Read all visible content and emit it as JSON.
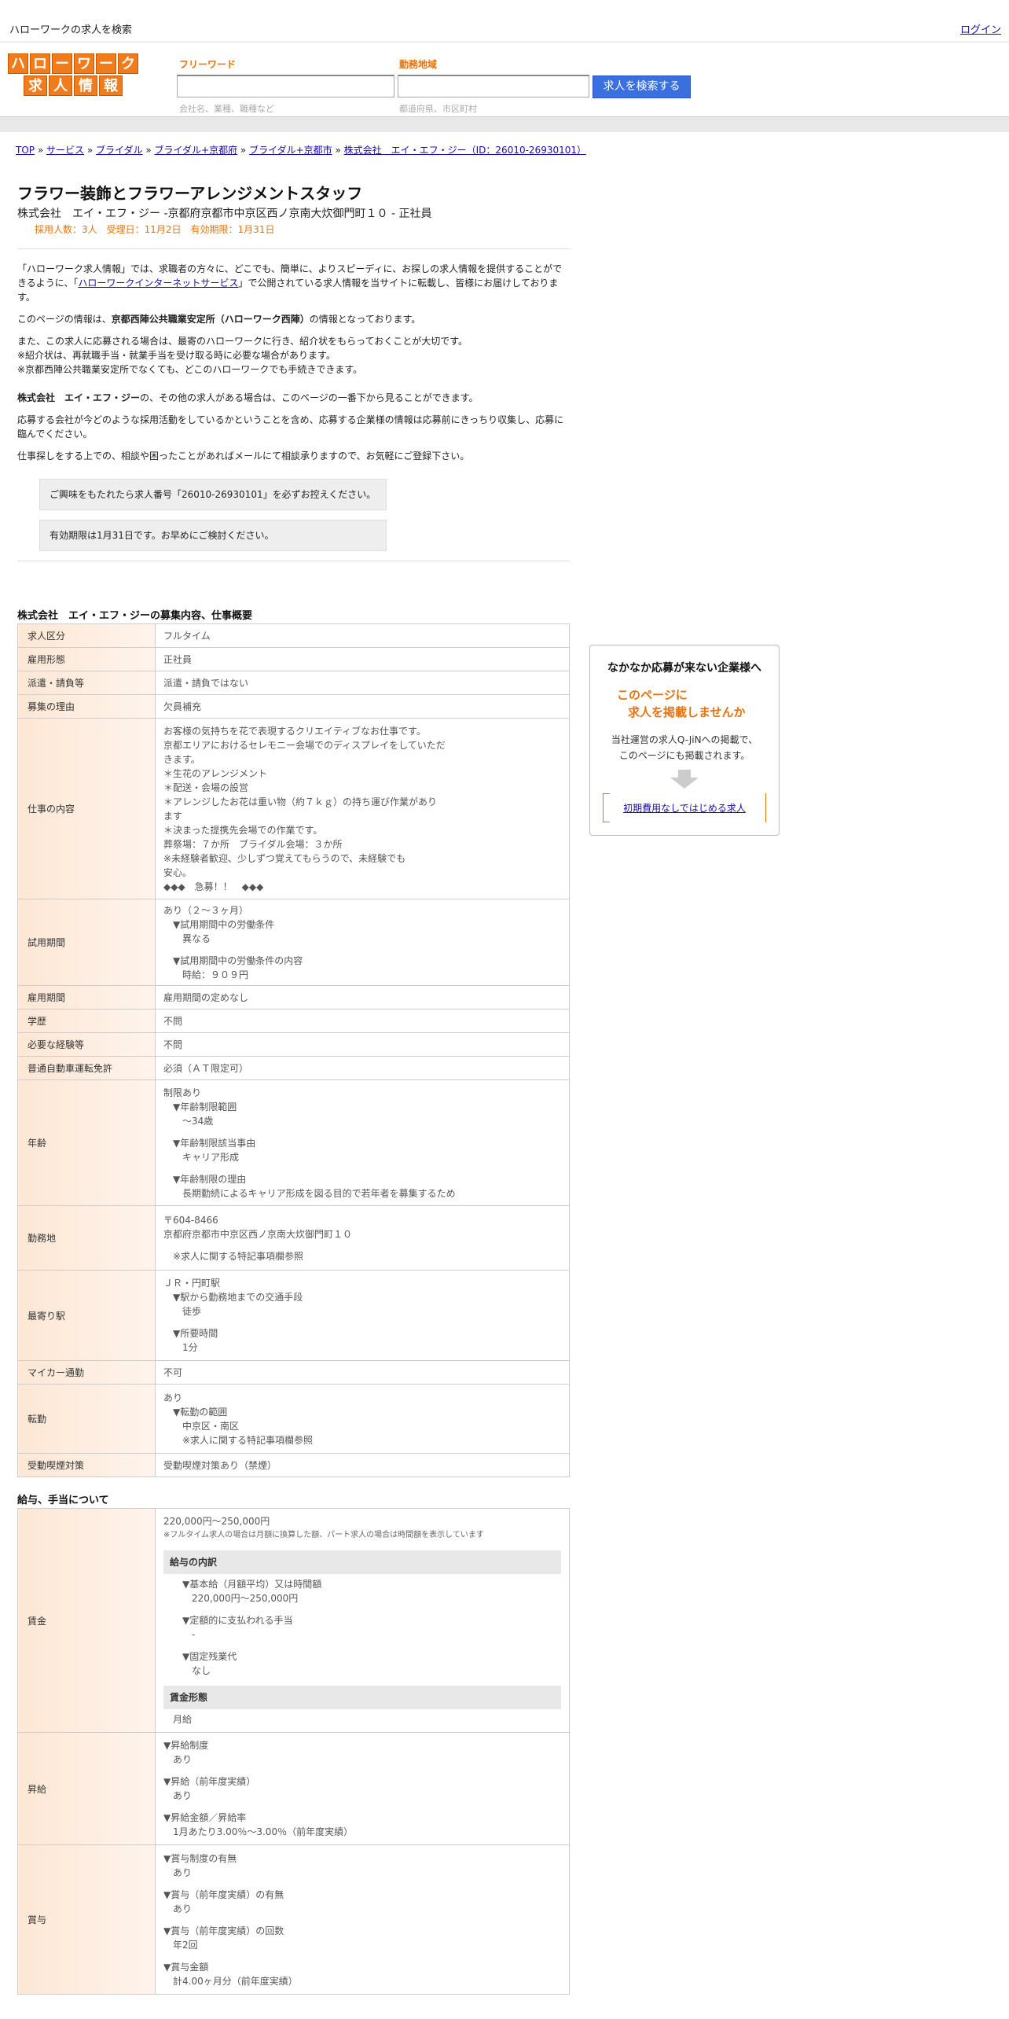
{
  "topbar": {
    "title": "ハローワークの求人を検索",
    "login": "ログイン"
  },
  "logo": {
    "row1": [
      "ハ",
      "ロ",
      "ー",
      "ワ",
      "ー",
      "ク"
    ],
    "row2": [
      "求",
      "人",
      "情",
      "報"
    ]
  },
  "search": {
    "free_label": "フリーワード",
    "free_hint": "会社名、業種、職種など",
    "area_label": "勤務地域",
    "area_hint": "都道府県、市区町村",
    "button": "求人を検索する"
  },
  "breadcrumb": {
    "items": [
      "TOP",
      "サービス",
      "ブライダル",
      "ブライダル+京都府",
      "ブライダル+京都市",
      "株式会社　エイ・エフ・ジー（ID：26010-26930101）"
    ],
    "sep": " » "
  },
  "job": {
    "title": "フラワー装飾とフラワーアレンジメントスタッフ",
    "subtitle": "株式会社　エイ・エフ・ジー -京都府京都市中京区西ノ京南大炊御門町１０ - 正社員",
    "meta": "採用人数：3人　受理日：11月2日　有効期限：1月31日"
  },
  "intro": {
    "p1a": "「ハローワーク求人情報」では、求職者の方々に、どこでも、簡単に、よりスピーディに、お探しの求人情報を提供することができるように、「",
    "p1link": "ハローワークインターネットサービス",
    "p1b": "」で公開されている求人情報を当サイトに転載し、皆様にお届けしております。",
    "p2a": "このページの情報は、",
    "p2b": "京都西陣公共職業安定所（ハローワーク西陣）",
    "p2c": "の情報となっております。",
    "p3a": "また、この求人に応募される場合は、最寄のハローワークに行き、紹介状をもらっておくことが大切です。",
    "p3b": "※紹介状は、再就職手当・就業手当を受け取る時に必要な場合があります。",
    "p3c": "※京都西陣公共職業安定所でなくても、どこのハローワークでも手続きできます。",
    "p4a": "株式会社　エイ・エフ・ジー",
    "p4b": "の、その他の求人がある場合は、このページの一番下から見ることができます。",
    "p5": "応募する会社が今どのような採用活動をしているかということを含め、応募する企業様の情報は応募前にきっちり収集し、応募に臨んでください。",
    "p6": "仕事探しをする上での、相談や困ったことがあればメールにて相談承りますので、お気軽にご登録下さい。",
    "note1": "ご興味をもたれたら求人番号「26010-26930101」を必ずお控えください。",
    "note2": "有効期限は1月31日です。お早めにご検討ください。"
  },
  "section1": {
    "title": "株式会社　エイ・エフ・ジーの募集内容、仕事概要",
    "rows": [
      {
        "k": "求人区分",
        "v": [
          "フルタイム"
        ]
      },
      {
        "k": "雇用形態",
        "v": [
          "正社員"
        ]
      },
      {
        "k": "派遣・請負等",
        "v": [
          "派遣・請負ではない"
        ]
      },
      {
        "k": "募集の理由",
        "v": [
          "欠員補充"
        ]
      },
      {
        "k": "仕事の内容",
        "v": [
          "お客様の気持ちを花で表現するクリエイティブなお仕事です。",
          "京都エリアにおけるセレモニー会場でのディスプレイをしていただ",
          "きます。",
          "＊生花のアレンジメント",
          "＊配送・会場の設営",
          "＊アレンジしたお花は重い物（約７ｋｇ）の持ち運び作業があり",
          "　ます",
          "＊決まった提携先会場での作業です。",
          "　葬祭場：７か所　ブライダル会場：３か所",
          "※未経験者歓迎、少しずつ覚えてもらうので、未経験でも",
          "　安心。",
          "　◆◆◆　急募！！　◆◆◆"
        ]
      },
      {
        "k": "試用期間",
        "v": [
          "あり（２～３ヶ月）",
          "  ▼試用期間中の労働条件",
          "    異なる",
          "",
          "  ▼試用期間中の労働条件の内容",
          "    時給：９０９円"
        ]
      },
      {
        "k": "雇用期間",
        "v": [
          "雇用期間の定めなし"
        ]
      },
      {
        "k": "学歴",
        "v": [
          "不問"
        ]
      },
      {
        "k": "必要な経験等",
        "v": [
          "不問"
        ]
      },
      {
        "k": "普通自動車運転免許",
        "v": [
          "必須（ＡＴ限定可）"
        ]
      },
      {
        "k": "年齢",
        "v": [
          "制限あり",
          "  ▼年齢制限範囲",
          "    〜34歳",
          "",
          "  ▼年齢制限該当事由",
          "    キャリア形成",
          "",
          "  ▼年齢制限の理由",
          "    長期勤続によるキャリア形成を図る目的で若年者を募集するため"
        ]
      },
      {
        "k": "勤務地",
        "v": [
          "〒604-8466",
          "京都府京都市中京区西ノ京南大炊御門町１０",
          "",
          "  ※求人に関する特記事項欄参照"
        ]
      },
      {
        "k": "最寄り駅",
        "v": [
          "ＪＲ・円町駅",
          "  ▼駅から勤務地までの交通手段",
          "    徒歩",
          "",
          "  ▼所要時間",
          "    1分"
        ]
      },
      {
        "k": "マイカー通勤",
        "v": [
          "不可"
        ]
      },
      {
        "k": "転勤",
        "v": [
          "あり",
          "  ▼転勤の範囲",
          "    中京区・南区",
          "    ※求人に関する特記事項欄参照"
        ]
      },
      {
        "k": "受動喫煙対策",
        "v": [
          "受動喫煙対策あり（禁煙）"
        ]
      }
    ]
  },
  "section2": {
    "title": "給与、手当について",
    "wage_k": "賃金",
    "wage_range": "220,000円〜250,000円",
    "wage_note": "※フルタイム求人の場合は月額に換算した額、パート求人の場合は時間額を表示しています",
    "breakdown_title": "給与の内訳",
    "breakdown": [
      "    ▼基本給（月額平均）又は時間額",
      "      220,000円〜250,000円",
      "",
      "    ▼定額的に支払われる手当",
      "      -",
      "",
      "    ▼固定残業代",
      "      なし"
    ],
    "form_title": "賃金形態",
    "form_value": "月給",
    "raise_k": "昇給",
    "raise": [
      "▼昇給制度",
      "  あり",
      "",
      "▼昇給（前年度実績）",
      "  あり",
      "",
      "▼昇給金額／昇給率",
      "  1月あたり3.00％〜3.00％（前年度実績）"
    ],
    "bonus_k": "賞与",
    "bonus": [
      "▼賞与制度の有無",
      "  あり",
      "",
      "▼賞与（前年度実績）の有無",
      "  あり",
      "",
      "▼賞与（前年度実績）の回数",
      "  年2回",
      "",
      "▼賞与金額",
      "  計4.00ヶ月分（前年度実績）"
    ]
  },
  "sidebar": {
    "heading": "なかなか応募が来ない企業様へ",
    "orange1": "このページに",
    "orange2": "求人を掲載しませんか",
    "desc1": "当社運営の求人Q-JiNへの掲載で、",
    "desc2": "このページにも掲載されます。",
    "link": "初期費用なしではじめる求人"
  }
}
